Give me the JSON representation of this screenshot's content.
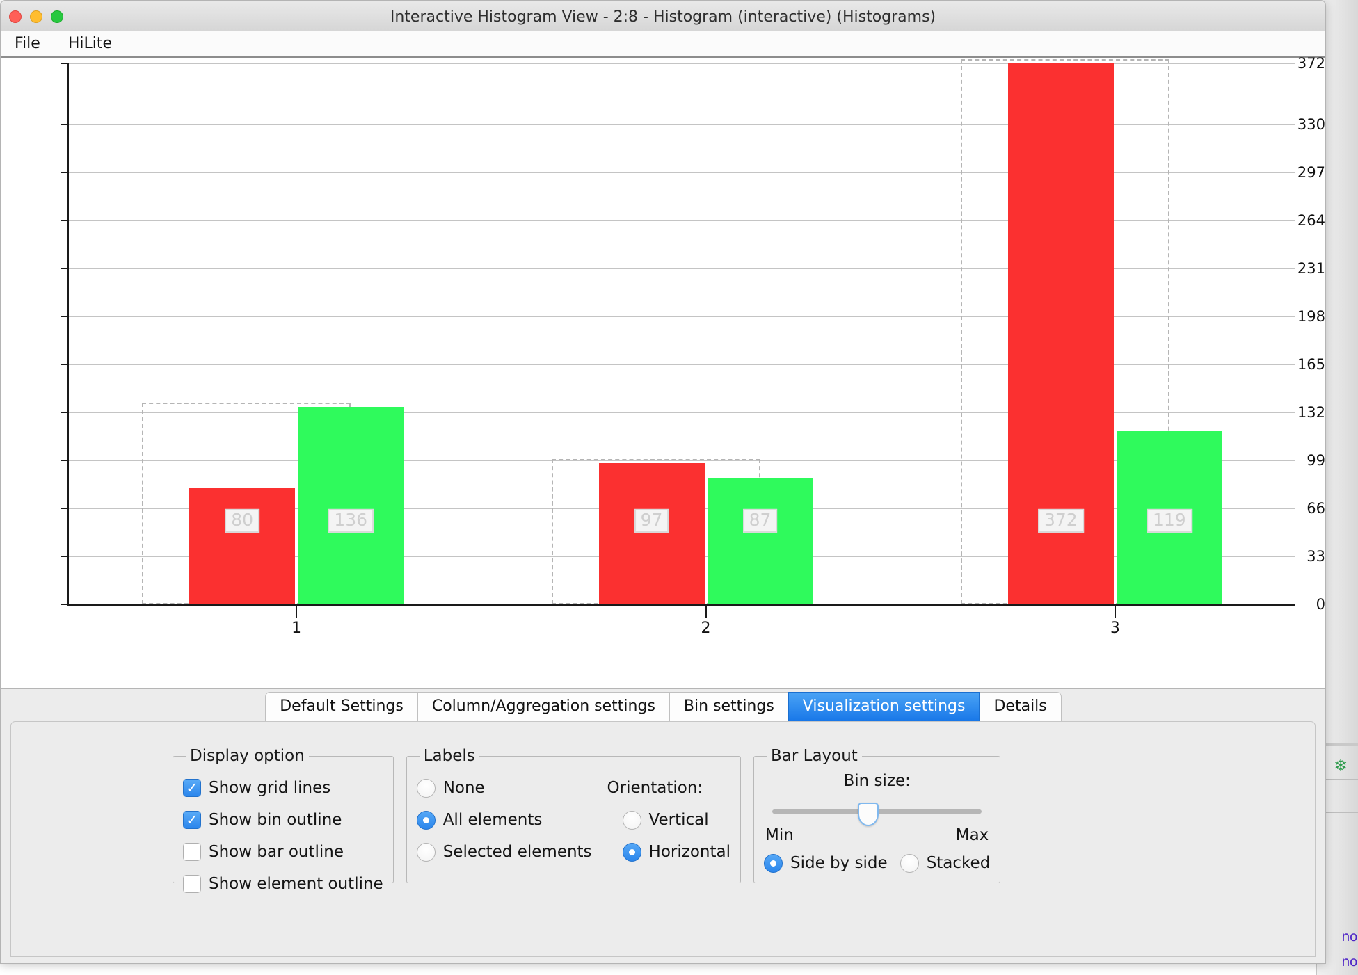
{
  "window": {
    "title": "Interactive Histogram View - 2:8 - Histogram (interactive) (Histograms)",
    "traffic_lights": [
      "close",
      "minimize",
      "zoom"
    ],
    "menu": [
      {
        "label": "File"
      },
      {
        "label": "HiLite"
      }
    ]
  },
  "background_window": {
    "leaf_icon": "leaf-icon",
    "text_fragments": [
      "no",
      "no"
    ]
  },
  "chart_data": {
    "type": "bar",
    "title": "",
    "xlabel": "",
    "ylabel": "",
    "categories": [
      "1",
      "2",
      "3"
    ],
    "series": [
      {
        "name": "red",
        "color": "#FB3030",
        "values": [
          80,
          97,
          372
        ]
      },
      {
        "name": "green",
        "color": "#2FFA5C",
        "values": [
          136,
          87,
          119
        ]
      }
    ],
    "bar_labels": [
      [
        "80",
        "136"
      ],
      [
        "97",
        "87"
      ],
      [
        "372",
        "119"
      ]
    ],
    "bin_outline_tops": [
      136,
      97,
      372
    ],
    "ylim": [
      0,
      372
    ],
    "yticks": [
      0,
      33,
      66,
      99,
      132,
      165,
      198,
      231,
      264,
      297,
      330,
      372
    ],
    "ytick_labels": [
      "0",
      "33",
      "66",
      "99",
      "132",
      "165",
      "198",
      "231",
      "264",
      "297",
      "330",
      "372"
    ],
    "xtick_labels": [
      "1",
      "2",
      "3"
    ],
    "grid": true,
    "legend": "none",
    "bar_layout": "side by side",
    "label_mode": "all elements",
    "label_orientation": "horizontal"
  },
  "settings": {
    "tabs": [
      {
        "label": "Default Settings",
        "active": false
      },
      {
        "label": "Column/Aggregation settings",
        "active": false
      },
      {
        "label": "Bin settings",
        "active": false
      },
      {
        "label": "Visualization settings",
        "active": true
      },
      {
        "label": "Details",
        "active": false
      }
    ],
    "display_option": {
      "legend": "Display option",
      "items": [
        {
          "label": "Show grid lines",
          "checked": true
        },
        {
          "label": "Show bin outline",
          "checked": true
        },
        {
          "label": "Show bar outline",
          "checked": false
        },
        {
          "label": "Show element outline",
          "checked": false
        }
      ]
    },
    "labels": {
      "legend": "Labels",
      "mode_options": [
        {
          "label": "None",
          "selected": false
        },
        {
          "label": "All elements",
          "selected": true
        },
        {
          "label": "Selected elements",
          "selected": false
        }
      ],
      "orientation_title": "Orientation:",
      "orientation_options": [
        {
          "label": "Vertical",
          "selected": false
        },
        {
          "label": "Horizontal",
          "selected": true
        }
      ]
    },
    "bar_layout": {
      "legend": "Bar Layout",
      "bin_size_title": "Bin size:",
      "slider": {
        "min_label": "Min",
        "max_label": "Max",
        "value_percent": 46
      },
      "layout_options": [
        {
          "label": "Side by side",
          "selected": true
        },
        {
          "label": "Stacked",
          "selected": false
        }
      ]
    }
  },
  "colors": {
    "accent": "#2b86ec",
    "bar_red": "#FB3030",
    "bar_green": "#2FFA5C",
    "grid": "#c4c4c4",
    "bin_outline": "#b5b5b5"
  }
}
